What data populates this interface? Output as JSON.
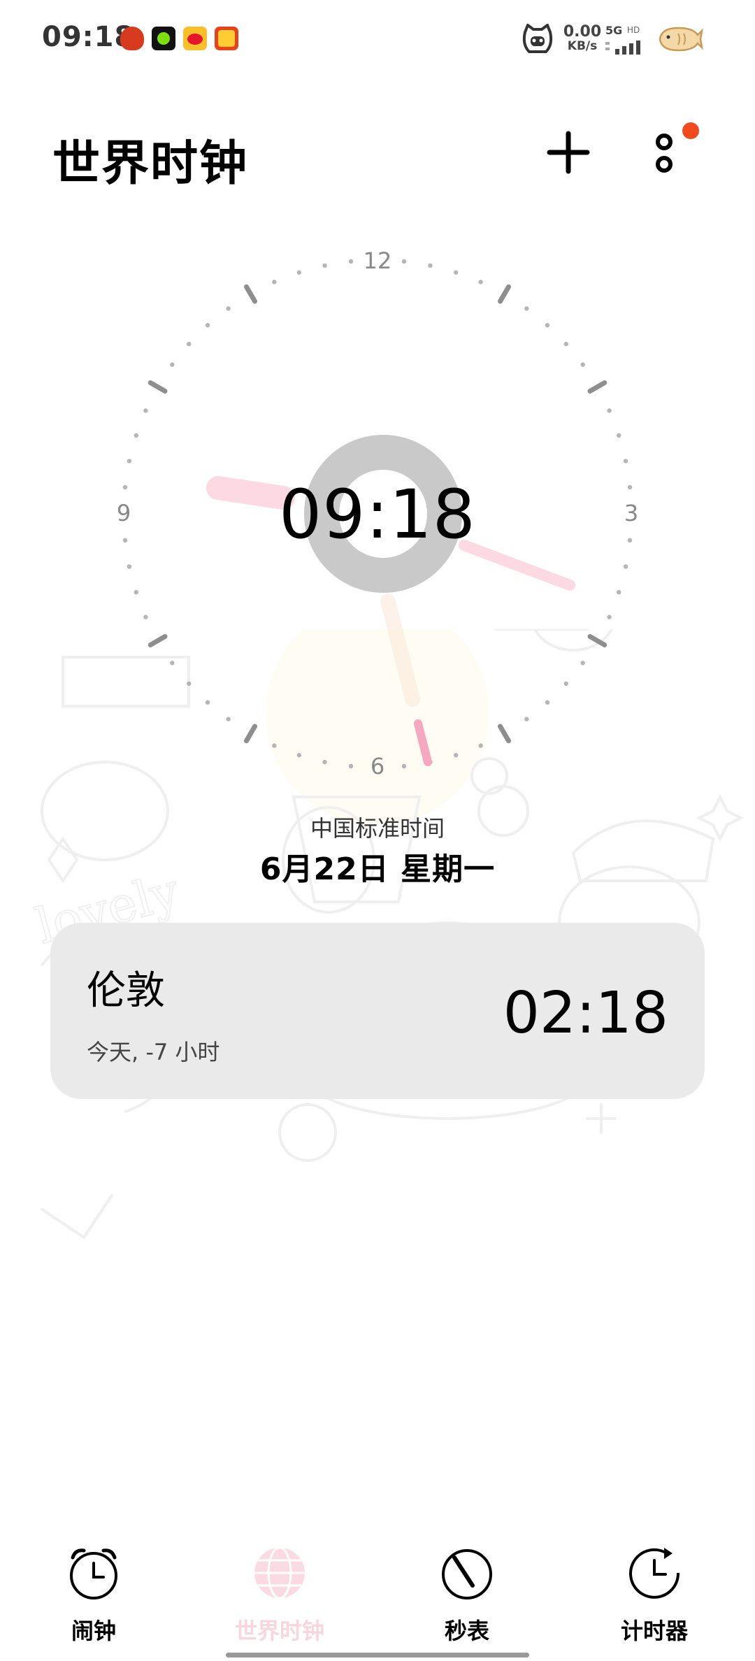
{
  "status_bar": {
    "time": "09:18",
    "net_speed_value": "0.00",
    "net_speed_unit": "KB/s",
    "network_type": "5G",
    "hd_label": "HD"
  },
  "header": {
    "title": "世界时钟"
  },
  "clock": {
    "digital_time": "09:18",
    "numerals": {
      "n12": "12",
      "n3": "3",
      "n6": "6",
      "n9": "9"
    },
    "timezone_name": "中国标准时间",
    "date": "6月22日  星期一"
  },
  "world_clocks": [
    {
      "city": "伦敦",
      "offset": "今天, -7 小时",
      "time": "02:18"
    }
  ],
  "bottom_nav": {
    "items": [
      {
        "label": "闹钟",
        "icon": "alarm-clock-icon",
        "active": false
      },
      {
        "label": "世界时钟",
        "icon": "globe-icon",
        "active": true
      },
      {
        "label": "秒表",
        "icon": "stopwatch-icon",
        "active": false
      },
      {
        "label": "计时器",
        "icon": "timer-icon",
        "active": false
      }
    ]
  },
  "colors": {
    "accent_pink": "#f7d6df",
    "notification_dot": "#f24a1c",
    "card_bg": "#e9e9e9"
  }
}
